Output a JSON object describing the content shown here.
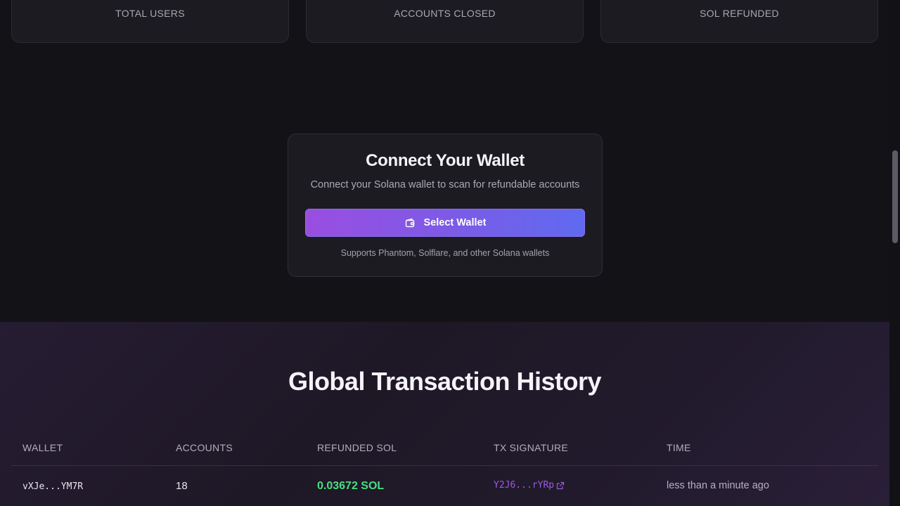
{
  "stats": [
    {
      "label": "TOTAL USERS"
    },
    {
      "label": "ACCOUNTS CLOSED"
    },
    {
      "label": "SOL REFUNDED"
    }
  ],
  "connect": {
    "title": "Connect Your Wallet",
    "subtitle": "Connect your Solana wallet to scan for refundable accounts",
    "button_label": "Select Wallet",
    "note": "Supports Phantom, Solflare, and other Solana wallets"
  },
  "history": {
    "title": "Global Transaction History",
    "columns": [
      "WALLET",
      "ACCOUNTS",
      "REFUNDED SOL",
      "TX SIGNATURE",
      "TIME"
    ],
    "rows": [
      {
        "wallet": "vXJe...YM7R",
        "accounts": "18",
        "refunded": "0.03672 SOL",
        "tx": "Y2J6...rYRp",
        "time": "less than a minute ago"
      }
    ]
  },
  "colors": {
    "accent": "#9d5ae6",
    "success": "#4ade80",
    "background": "#131217"
  },
  "icons": {
    "button_icon": "wallet-icon",
    "tx_link_icon": "external-link-icon"
  }
}
